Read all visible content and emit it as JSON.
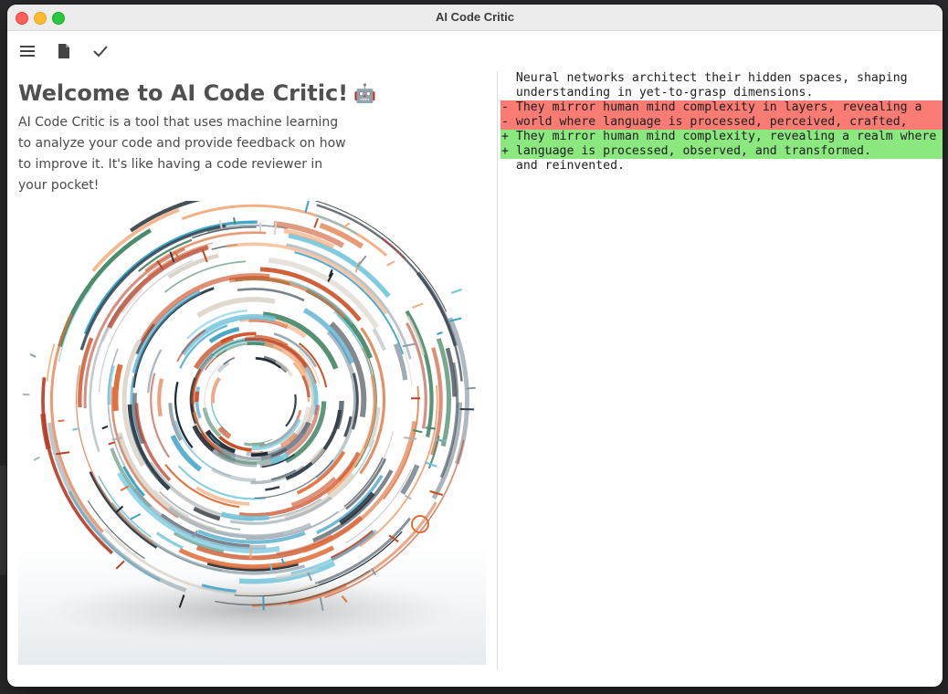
{
  "window": {
    "title": "AI Code Critic"
  },
  "toolbar": {
    "icons": [
      "menu-icon",
      "document-icon",
      "checkmark-icon"
    ]
  },
  "welcome": {
    "title": "Welcome to AI Code Critic!",
    "emoji": "🤖",
    "description": "AI Code Critic is a tool that uses machine learning to analyze your code and provide feedback on how to improve it. It's like having a code reviewer in your pocket!"
  },
  "diff": {
    "lines": [
      {
        "type": "context",
        "prefix": " ",
        "text": "Neural networks architect their hidden spaces, shaping"
      },
      {
        "type": "context",
        "prefix": " ",
        "text": "understanding in yet-to-grasp dimensions."
      },
      {
        "type": "removed",
        "prefix": "-",
        "text": "They mirror human mind complexity in layers, revealing a"
      },
      {
        "type": "removed",
        "prefix": "-",
        "text": "world where language is processed, perceived, crafted,"
      },
      {
        "type": "added",
        "prefix": "+",
        "text": "They mirror human mind complexity, revealing a realm where"
      },
      {
        "type": "added",
        "prefix": "+",
        "text": "language is processed, observed, and transformed."
      },
      {
        "type": "context",
        "prefix": " ",
        "text": "and reinvented."
      }
    ]
  },
  "colors": {
    "removed_bg": "#f87c73",
    "added_bg": "#8be87f",
    "close": "#ff5f57",
    "minimize": "#febc2e",
    "maximize": "#28c840"
  }
}
